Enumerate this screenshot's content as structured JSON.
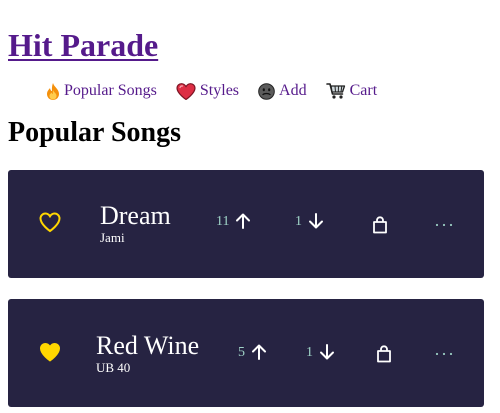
{
  "site": {
    "title": "Hit Parade"
  },
  "nav": [
    {
      "label": "Popular Songs",
      "icon": "fire-icon"
    },
    {
      "label": "Styles",
      "icon": "heart-icon"
    },
    {
      "label": "Add",
      "icon": "face-icon"
    },
    {
      "label": "Cart",
      "icon": "cart-icon"
    }
  ],
  "section": {
    "title": "Popular Songs"
  },
  "songs": [
    {
      "name": "Dream",
      "artist": "Jami",
      "favorite": false,
      "upvotes": "11",
      "downvotes": "1"
    },
    {
      "name": "Red Wine",
      "artist": "UB 40",
      "favorite": true,
      "upvotes": "5",
      "downvotes": "1"
    }
  ],
  "colors": {
    "title_link": "#551A8B",
    "card_bg": "#262342",
    "heart": "#FFD700",
    "vote": "#9fd3c7"
  },
  "more_label": "···"
}
